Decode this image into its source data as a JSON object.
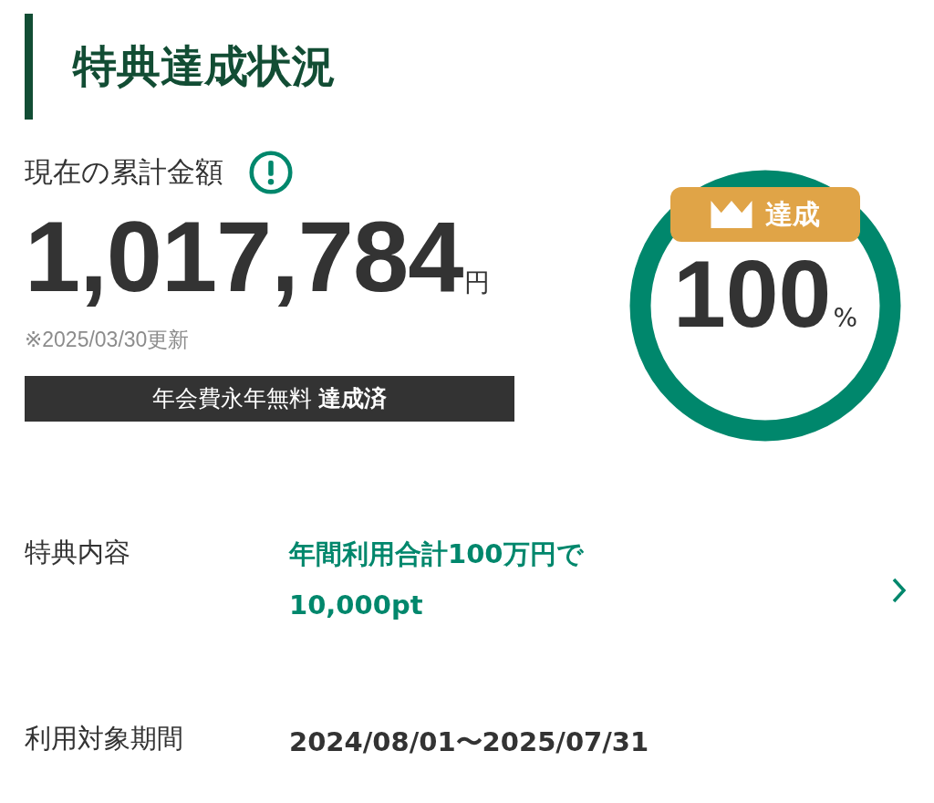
{
  "heading": {
    "title": "特典達成状況"
  },
  "summary": {
    "label": "現在の累計金額",
    "amount": "1,017,784",
    "unit": "円",
    "updated": "※2025/03/30更新",
    "status_bar": "年会費永年無料 **達成済**"
  },
  "progress": {
    "badge": "達成",
    "percent": "100",
    "unit": "%"
  },
  "details": [
    {
      "kind": "link",
      "label": "特典内容",
      "lines": [
        "年間利用合計100万円で",
        "10,000pt"
      ]
    },
    {
      "kind": "plain",
      "label": "利用対象期間",
      "lines": [
        "2024/08/01〜2025/07/31"
      ]
    }
  ]
}
